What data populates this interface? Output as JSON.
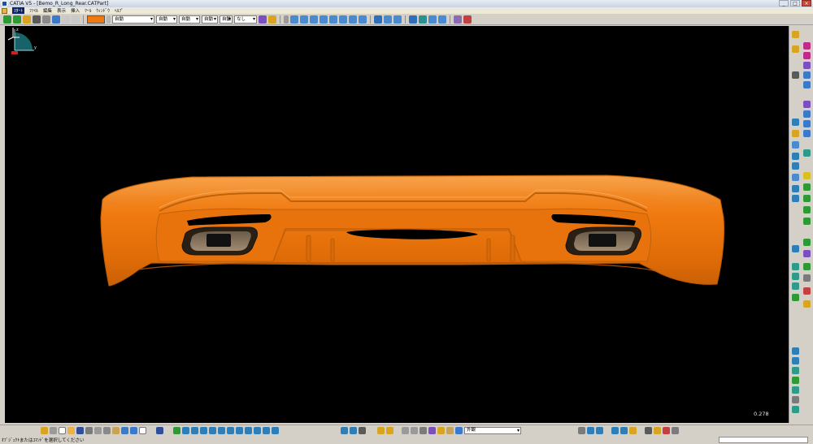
{
  "window": {
    "title": "CATIA V5 - [Bemo_R_Long_Rear.CATPart]",
    "controls": [
      "_",
      "□",
      "×"
    ]
  },
  "menubar": {
    "items": [
      "ｽﾀｰﾄ",
      "ﾌｧｲﾙ",
      "編集",
      "表示",
      "挿入",
      "ﾂｰﾙ",
      "ｳｨﾝﾄﾞｳ",
      "ﾍﾙﾌﾟ"
    ]
  },
  "toolbar": {
    "color_hex": "#f07a10",
    "combo_auto_1": "自動",
    "combo_auto_2": "自動",
    "combo_auto_3": "自動",
    "combo_linetype": "自動",
    "combo_layer": "自動",
    "combo_none": "なし"
  },
  "viewport": {
    "background": "#000000",
    "part_color": "#f07a10",
    "zoom_readout": "0.278",
    "compass_axes": {
      "z": "z",
      "y": "y",
      "x": "x"
    }
  },
  "bottombar": {
    "combo_material": "外観"
  },
  "status": {
    "message": "ｵﾌﾞｼﾞｪｸﾄまたはｺﾏﾝﾄﾞを選択してください"
  }
}
